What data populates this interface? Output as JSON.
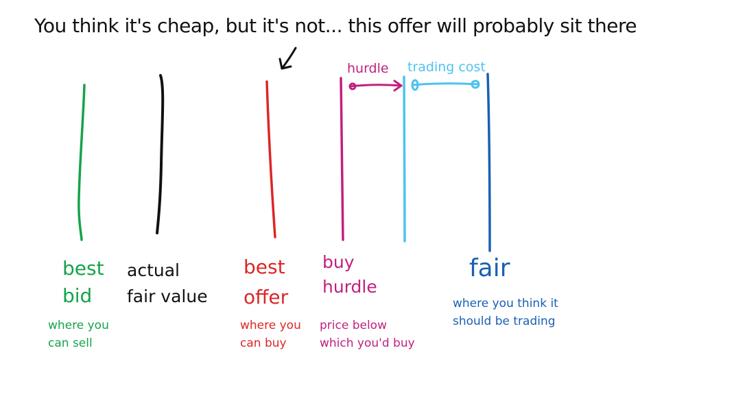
{
  "title": "You think it's cheap, but it's not... this offer will probably sit there",
  "colors": {
    "green": "#16a34a",
    "black": "#111111",
    "red": "#dc2626",
    "magenta": "#c0207f",
    "lightblue": "#4cc3ee",
    "blue": "#1a5fb4"
  },
  "labels": {
    "best_bid": {
      "line1": "best",
      "line2": "bid",
      "note1": "where you",
      "note2": "can sell"
    },
    "actual_fair": {
      "line1": "actual",
      "line2": "fair value"
    },
    "best_offer": {
      "line1": "best",
      "line2": "offer",
      "note1": "where you",
      "note2": "can buy"
    },
    "buy_hurdle": {
      "line1": "buy",
      "line2": "hurdle",
      "note1": "price below",
      "note2": "which you'd buy"
    },
    "fair": {
      "line1": "fair",
      "note1": "where you think it",
      "note2": "should be trading"
    }
  },
  "brackets": {
    "hurdle": "hurdle",
    "trading_cost": "trading cost"
  }
}
